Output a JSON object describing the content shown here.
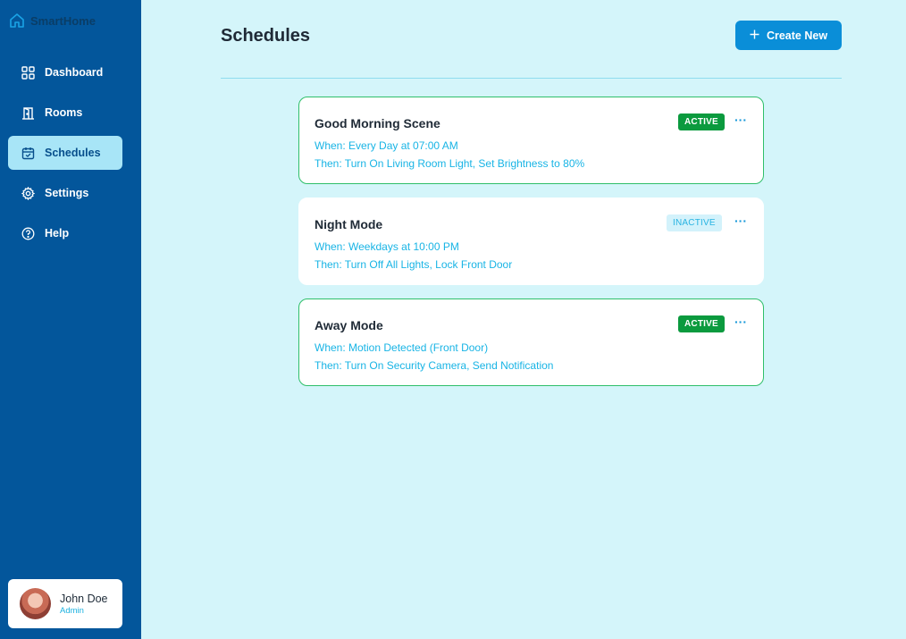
{
  "brand": {
    "name": "SmartHome",
    "icon": "home-icon"
  },
  "nav": [
    {
      "label": "Dashboard",
      "icon": "grid-icon",
      "active": false
    },
    {
      "label": "Rooms",
      "icon": "door-icon",
      "active": false
    },
    {
      "label": "Schedules",
      "icon": "calendar-check-icon",
      "active": true
    },
    {
      "label": "Settings",
      "icon": "gear-icon",
      "active": false
    },
    {
      "label": "Help",
      "icon": "help-circle-icon",
      "active": false
    }
  ],
  "user": {
    "name": "John Doe",
    "role": "Admin"
  },
  "header": {
    "title": "Schedules",
    "create_label": "Create New"
  },
  "schedules": [
    {
      "title": "Good Morning Scene",
      "when": "When: Every Day at 07:00 AM",
      "then": "Then: Turn On Living Room Light, Set Brightness to 80%",
      "status": "ACTIVE"
    },
    {
      "title": "Night Mode",
      "when": "When: Weekdays at 10:00 PM",
      "then": "Then: Turn Off All Lights, Lock Front Door",
      "status": "INACTIVE"
    },
    {
      "title": "Away Mode",
      "when": "When: Motion Detected (Front Door)",
      "then": "Then: Turn On Security Camera, Send Notification",
      "status": "ACTIVE"
    }
  ],
  "colors": {
    "sidebar": "#03569b",
    "accent": "#0a8ed8",
    "active_badge": "#0b9a3e",
    "background": "#d4f5fa"
  }
}
